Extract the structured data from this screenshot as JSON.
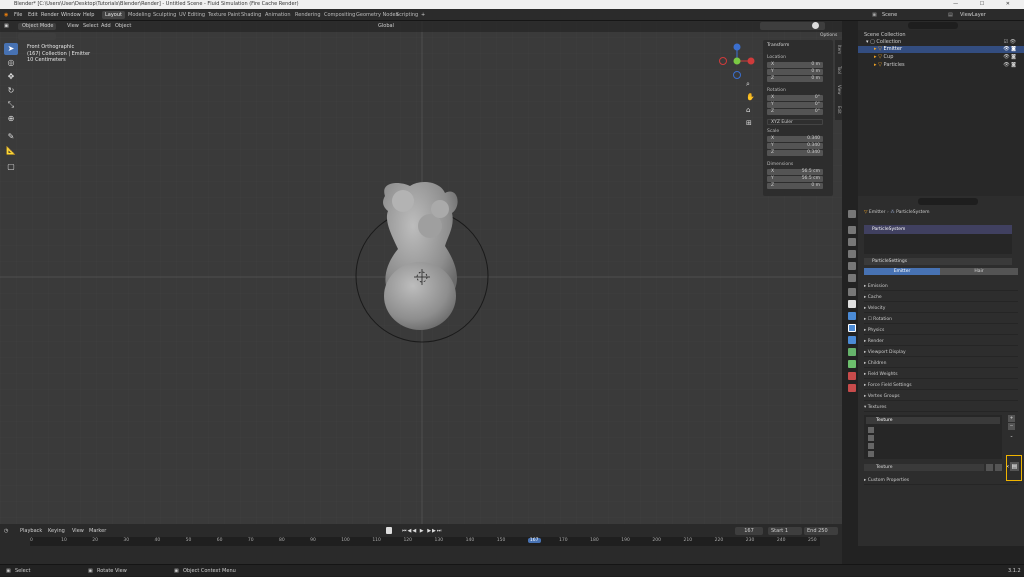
{
  "window": {
    "title": "Blender* [C:\\Users\\User\\Desktop\\Tutorials\\Blender\\Render] - Untitled Scene - Fluid Simulation (Fire Cache Render)",
    "controls": "— ☐ ✕"
  },
  "topbar": {
    "menus": [
      "File",
      "Edit",
      "Render",
      "Window",
      "Help"
    ],
    "workspaces": [
      "Layout",
      "Modeling",
      "Sculpting",
      "UV Editing",
      "Texture Paint",
      "Shading",
      "Animation",
      "Rendering",
      "Compositing",
      "Geometry Nodes",
      "Scripting"
    ],
    "active_workspace": "Layout",
    "scene_label": "Scene",
    "view_layer_label": "ViewLayer"
  },
  "viewport": {
    "mode": "Object Mode",
    "menus": [
      "View",
      "Select",
      "Add",
      "Object"
    ],
    "transform_orientation": "Global",
    "info_line1": "Front Orthographic",
    "info_line2": "(167) Collection | Emitter",
    "info_line3": "10 Centimeters",
    "options_label": "Options"
  },
  "n_panel": {
    "header": "Transform",
    "location_label": "Location",
    "location": [
      {
        "axis": "X",
        "value": "0 m"
      },
      {
        "axis": "Y",
        "value": "0 m"
      },
      {
        "axis": "Z",
        "value": "0 m"
      }
    ],
    "rotation_label": "Rotation",
    "rotation": [
      {
        "axis": "X",
        "value": "0°"
      },
      {
        "axis": "Y",
        "value": "0°"
      },
      {
        "axis": "Z",
        "value": "0°"
      }
    ],
    "rotation_mode": "XYZ Euler",
    "scale_label": "Scale",
    "scale": [
      {
        "axis": "X",
        "value": "0.340"
      },
      {
        "axis": "Y",
        "value": "0.340"
      },
      {
        "axis": "Z",
        "value": "0.340"
      }
    ],
    "dimensions_label": "Dimensions",
    "dimensions": [
      {
        "axis": "X",
        "value": "56.5 cm"
      },
      {
        "axis": "Y",
        "value": "56.5 cm"
      },
      {
        "axis": "Z",
        "value": "0 m"
      }
    ],
    "side_tabs": [
      "Item",
      "Tool",
      "View",
      "Edit"
    ]
  },
  "outliner": {
    "title": "Scene Collection",
    "items": [
      {
        "name": "Collection",
        "depth": 1
      },
      {
        "name": "Emitter",
        "depth": 2,
        "selected": true
      },
      {
        "name": "Cup",
        "depth": 2
      },
      {
        "name": "Particles",
        "depth": 2
      }
    ]
  },
  "properties": {
    "breadcrumb_object": "Emitter",
    "breadcrumb_psys": "ParticleSystem",
    "psys_slot": "ParticleSystem",
    "settings_name": "ParticleSettings",
    "toggle_emitter": "Emitter",
    "toggle_hair": "Hair",
    "sections": [
      "Emission",
      "Cache",
      "Velocity",
      "Rotation",
      "Physics",
      "Render",
      "Viewport Display",
      "Children",
      "Field Weights",
      "Force Field Settings",
      "Vertex Groups",
      "Textures"
    ],
    "texture_slot": "Texture",
    "texture_name": "Texture",
    "custom_props": "Custom Properties"
  },
  "timeline": {
    "menus": [
      "Playback",
      "Keying",
      "View",
      "Marker"
    ],
    "current_frame": "167",
    "start_label": "Start",
    "start": "1",
    "end_label": "End",
    "end": "250",
    "ruler": [
      "0",
      "10",
      "20",
      "30",
      "40",
      "50",
      "60",
      "70",
      "80",
      "90",
      "100",
      "110",
      "120",
      "130",
      "140",
      "150",
      "167",
      "170",
      "180",
      "190",
      "200",
      "210",
      "220",
      "230",
      "240",
      "250"
    ]
  },
  "statusbar": {
    "left1": "Select",
    "left2": "Rotate View",
    "left3": "Object Context Menu",
    "version": "3.1.2"
  },
  "colors": {
    "accent": "#4772b3",
    "highlight": "#f0b400",
    "selected_row": "#334d80"
  }
}
